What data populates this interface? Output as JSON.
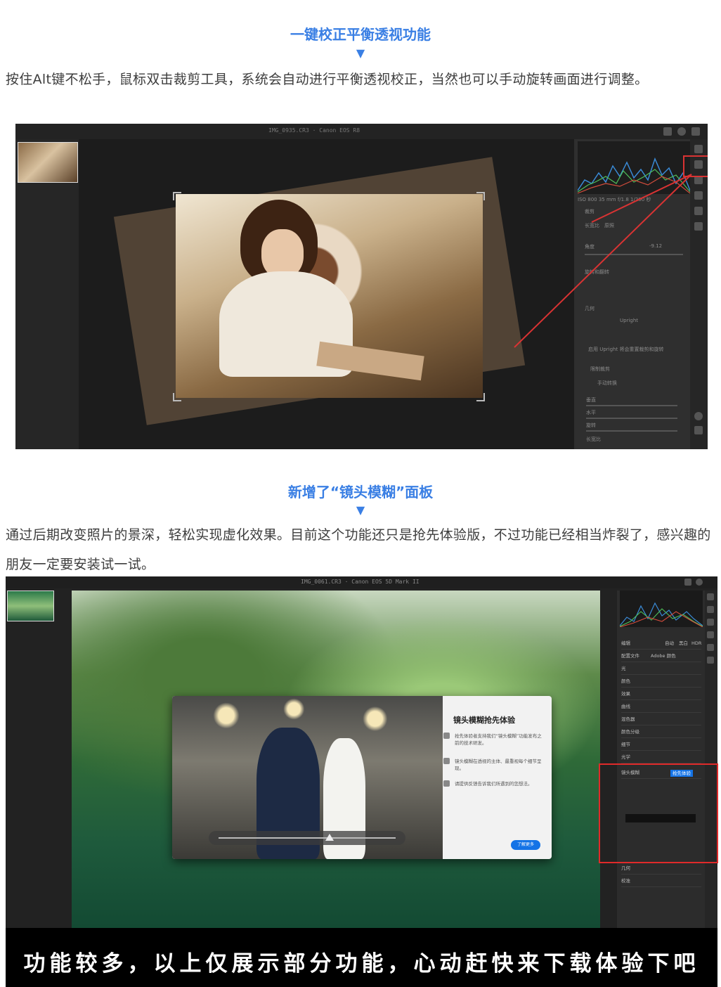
{
  "section1": {
    "heading": "一键校正平衡透视功能",
    "arrow": "▼",
    "paragraph": "按住Alt键不松手，鼠标双击裁剪工具，系统会自动进行平衡透视校正，当然也可以手动旋转画面进行调整。",
    "screenshot": {
      "title": "IMG_0935.CR3 · Canon EOS R8",
      "panel_labels": [
        "裁剪",
        "长宽比",
        "原照",
        "角度",
        "旋转和翻转",
        "几何",
        "Upright",
        "启用 Upright 将会重置裁剪和旋转",
        "限制裁剪",
        "手动转换",
        "垂直",
        "水平",
        "旋转",
        "长宽比"
      ],
      "histogram_readout": "ISO 800    35 mm    f/1.8    1/200 秒",
      "angle_value": "-9.12"
    }
  },
  "section2": {
    "heading": "新增了“镜头模糊”面板",
    "arrow": "▼",
    "paragraph": "通过后期改变照片的景深，轻松实现虚化效果。目前这个功能还只是抢先体验版，不过功能已经相当炸裂了，感兴趣的朋友一定要安装试一试。",
    "screenshot": {
      "title": "IMG_0061.CR3 · Canon EOS 5D Mark II",
      "dialog": {
        "title": "镜头模糊抢先体验",
        "items": [
          "抢先体验者支持我们“镜头模糊”功能发布之前的技术研发。",
          "镜头模糊在透视的主体、最重视每个细节呈现。",
          "请提供反馈告诉我们所遇到的您想法。"
        ],
        "button": "了解更多"
      },
      "panel": {
        "rows": [
          "编辑",
          "配置文件",
          "光",
          "颜色",
          "效果",
          "曲线",
          "混色器",
          "颜色分级",
          "细节",
          "光学",
          "镜头模糊",
          "几何",
          "校准"
        ],
        "badge": "抢先体验",
        "profile_value": "Adobe 颜色",
        "auto_label": "自动",
        "bw_label": "黑白",
        "hdr_label": "HDR"
      }
    }
  },
  "banner": {
    "text": "功能较多，以上仅展示部分功能，心动赶快来下载体验下吧"
  },
  "colors": {
    "heading_blue": "#3a7fe4",
    "highlight_red": "#e02a2a",
    "banner_bg": "#000000"
  }
}
